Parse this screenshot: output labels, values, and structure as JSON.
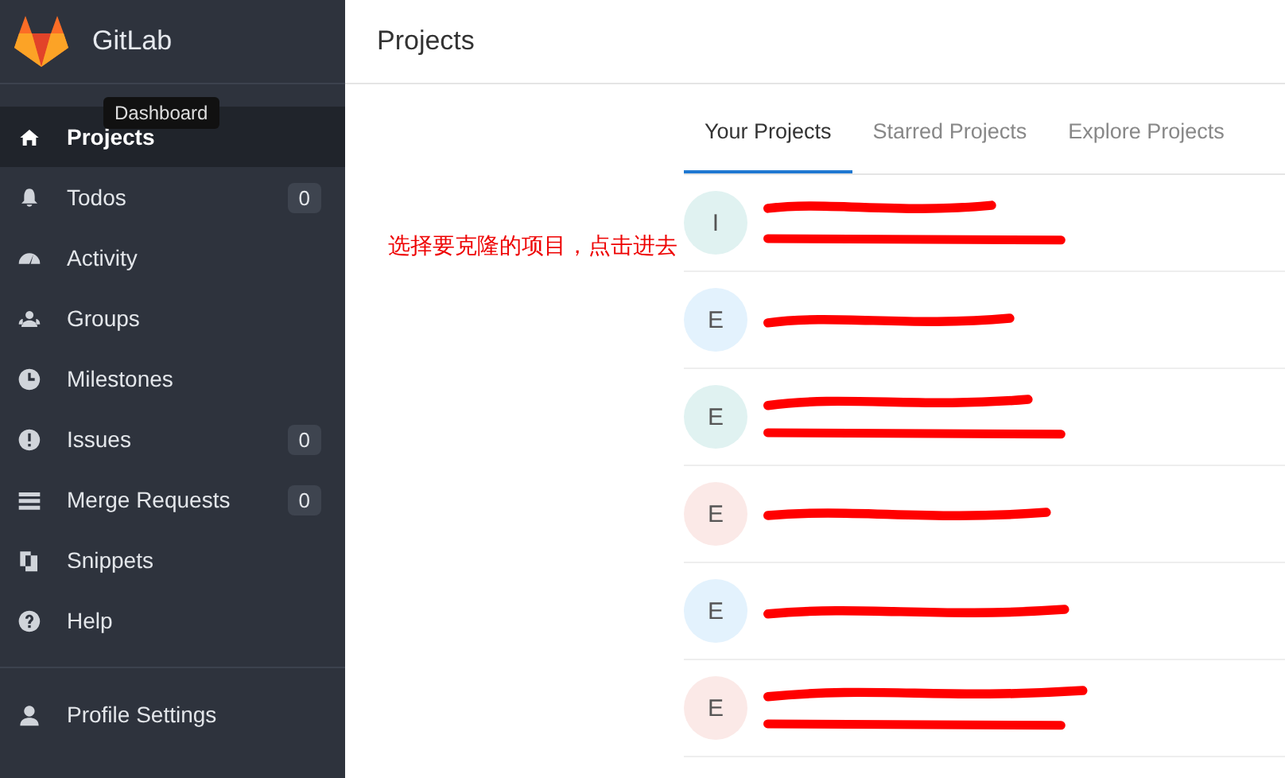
{
  "brand": {
    "name": "GitLab"
  },
  "tooltip": "Dashboard",
  "nav": [
    {
      "label": "Projects",
      "selected": true
    },
    {
      "label": "Todos",
      "count": "0",
      "selected": false
    },
    {
      "label": "Activity",
      "selected": false
    },
    {
      "label": "Groups",
      "selected": false
    },
    {
      "label": "Milestones",
      "selected": false
    },
    {
      "label": "Issues",
      "count": "0",
      "selected": false
    },
    {
      "label": "Merge Requests",
      "count": "0",
      "selected": false
    },
    {
      "label": "Snippets",
      "selected": false
    },
    {
      "label": "Help",
      "selected": false
    }
  ],
  "profile": {
    "label": "Profile Settings"
  },
  "page_title": "Projects",
  "note": "选择要克隆的项目，点击进去",
  "tabs": [
    {
      "label": "Your Projects",
      "selected": true
    },
    {
      "label": "Starred Projects",
      "selected": false
    },
    {
      "label": "Explore Projects",
      "selected": false
    }
  ],
  "projects": [
    {
      "letter": "I",
      "color": "#e0f2f1",
      "description": true
    },
    {
      "letter": "E",
      "color": "#e3f2fd",
      "description": false
    },
    {
      "letter": "E",
      "color": "#e0f2f1",
      "description": true
    },
    {
      "letter": "E",
      "color": "#fbe9e7",
      "description": false
    },
    {
      "letter": "E",
      "color": "#e3f2fd",
      "description": false
    },
    {
      "letter": "E",
      "color": "#fbe9e7",
      "description": true
    }
  ]
}
